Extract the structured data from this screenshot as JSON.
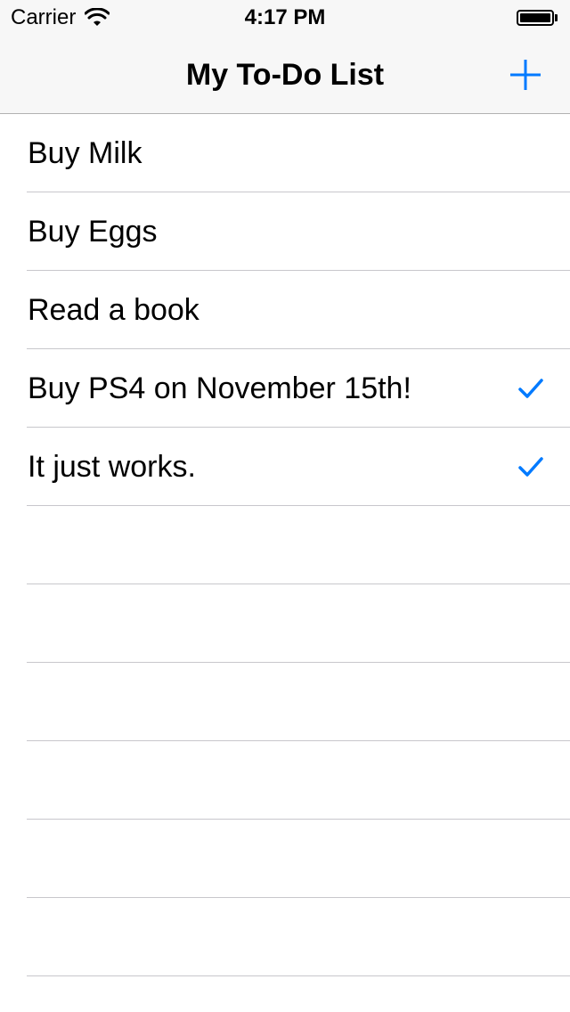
{
  "status_bar": {
    "carrier": "Carrier",
    "time": "4:17 PM",
    "battery_level": 1.0
  },
  "nav_bar": {
    "title": "My To-Do List",
    "add_icon": "plus-icon"
  },
  "accent_color": "#007aff",
  "todo_items": [
    {
      "label": "Buy Milk",
      "completed": false
    },
    {
      "label": "Buy Eggs",
      "completed": false
    },
    {
      "label": "Read a book",
      "completed": false
    },
    {
      "label": "Buy PS4 on November 15th!",
      "completed": true
    },
    {
      "label": "It just works.",
      "completed": true
    }
  ],
  "check_icon": "checkmark-icon"
}
